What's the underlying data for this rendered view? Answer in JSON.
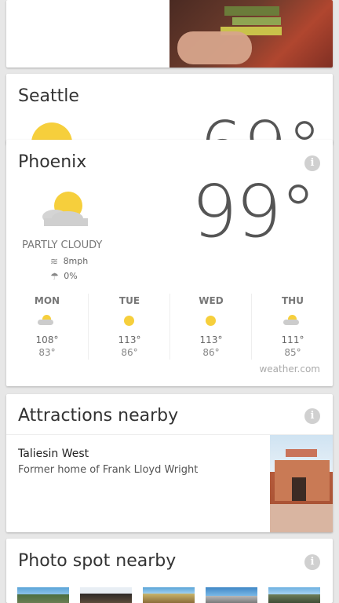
{
  "seattle": {
    "title": "Seattle",
    "temp": "69°"
  },
  "phoenix": {
    "title": "Phoenix",
    "temp": "99°",
    "condition": "PARTLY CLOUDY",
    "wind": "8mph",
    "precip": "0%",
    "forecast": [
      {
        "day": "MON",
        "icon": "partly-cloudy-icon",
        "high": "108°",
        "low": "83°"
      },
      {
        "day": "TUE",
        "icon": "sun-icon",
        "high": "113°",
        "low": "86°"
      },
      {
        "day": "WED",
        "icon": "sun-icon",
        "high": "113°",
        "low": "86°"
      },
      {
        "day": "THU",
        "icon": "partly-cloudy-icon",
        "high": "111°",
        "low": "85°"
      }
    ],
    "source": "weather.com"
  },
  "attractions": {
    "title": "Attractions nearby",
    "item": {
      "name": "Taliesin West",
      "desc": "Former home of Frank Lloyd Wright"
    }
  },
  "photo_spot": {
    "title": "Photo spot nearby"
  },
  "icons": {
    "info": "i"
  },
  "colors": {
    "sun": "#f6cf3c",
    "cloud": "#cfcfcf",
    "card": "#ffffff",
    "background": "#e7e7e7"
  }
}
